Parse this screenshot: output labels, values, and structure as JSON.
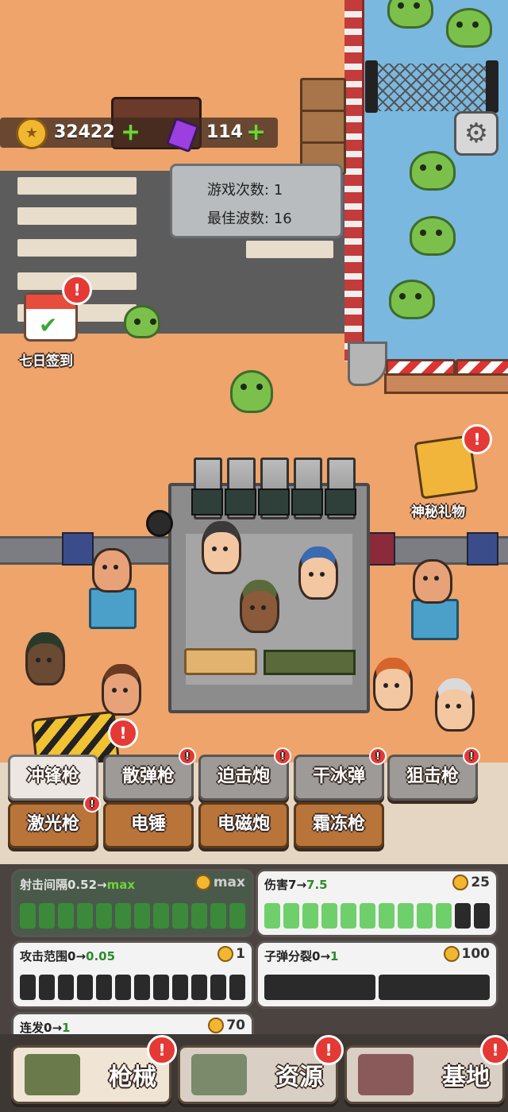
{
  "currency": {
    "coins": "32422",
    "gems": "114",
    "coin_icon": "coin-icon",
    "gem_icon": "gem-icon",
    "plus": "+"
  },
  "stats": {
    "games_played_label": "游戏次数:",
    "games_played": "1",
    "best_wave_label": "最佳波数:",
    "best_wave": "16"
  },
  "settings": {
    "icon": "gear-icon",
    "glyph": "⚙"
  },
  "side": {
    "checkin_label": "七日签到",
    "gift_label": "神秘礼物",
    "alert": "!"
  },
  "weapon_tabs": [
    {
      "label": "冲锋枪",
      "active": true,
      "alert": false
    },
    {
      "label": "散弹枪",
      "active": false,
      "alert": true
    },
    {
      "label": "迫击炮",
      "active": false,
      "alert": true
    },
    {
      "label": "干冰弹",
      "active": false,
      "alert": true
    },
    {
      "label": "狙击枪",
      "active": false,
      "alert": true
    },
    {
      "label": "激光枪",
      "active": false,
      "alert": true
    },
    {
      "label": "电锤",
      "active": false,
      "alert": false
    },
    {
      "label": "电磁炮",
      "active": false,
      "alert": false
    },
    {
      "label": "霜冻枪",
      "active": false,
      "alert": false
    }
  ],
  "upgrades": [
    {
      "label": "射击间隔0.52",
      "arrow": "→",
      "next": "max",
      "cost": "max",
      "level": 12,
      "total": 12,
      "maxed": true
    },
    {
      "label": "伤害7",
      "arrow": "→",
      "next": "7.5",
      "cost": "25",
      "level": 10,
      "total": 12,
      "maxed": false
    },
    {
      "label": "攻击范围0",
      "arrow": "→",
      "next": "0.05",
      "cost": "1",
      "level": 0,
      "total": 12,
      "maxed": false
    },
    {
      "label": "子弹分裂0",
      "arrow": "→",
      "next": "1",
      "cost": "100",
      "level": 0,
      "total": 2,
      "maxed": false
    },
    {
      "label": "连发0",
      "arrow": "→",
      "next": "1",
      "cost": "70",
      "level": 0,
      "total": 2,
      "maxed": false
    }
  ],
  "nav": [
    {
      "label": "枪械",
      "icon": "gun-icon",
      "alert": true,
      "active": true
    },
    {
      "label": "资源",
      "icon": "resource-icon",
      "alert": true,
      "active": false
    },
    {
      "label": "基地",
      "icon": "base-icon",
      "alert": true,
      "active": false
    }
  ]
}
